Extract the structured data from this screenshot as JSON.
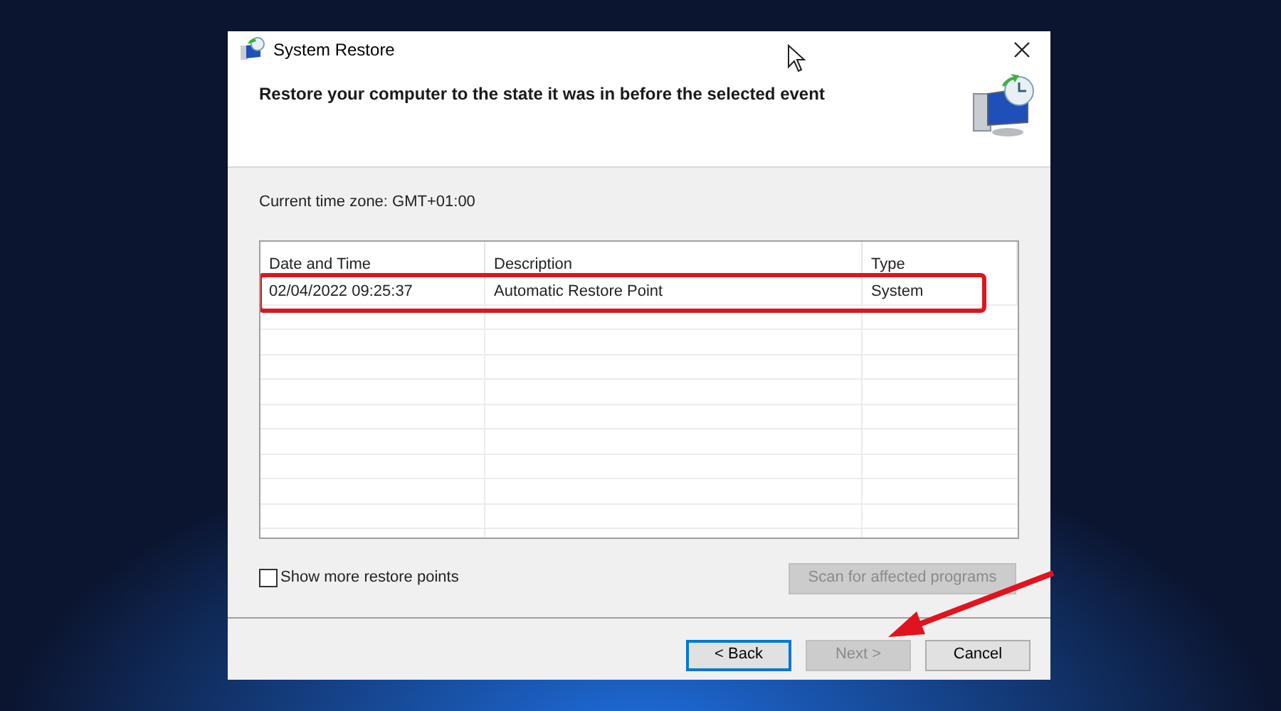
{
  "window": {
    "title": "System Restore"
  },
  "heading": "Restore your computer to the state it was in before the selected event",
  "time_zone": "Current time zone: GMT+01:00",
  "table": {
    "columns": [
      "Date and Time",
      "Description",
      "Type"
    ],
    "rows": [
      {
        "cells": [
          "02/04/2022 09:25:37",
          "Automatic Restore Point",
          "System"
        ],
        "highlighted": true
      }
    ]
  },
  "show_more": {
    "label": "Show more restore points",
    "checked": false
  },
  "scan_button": {
    "label": "Scan for affected programs",
    "disabled": true
  },
  "buttons": [
    {
      "label": "< Back",
      "disabled": false,
      "default": true
    },
    {
      "label": "Next >",
      "disabled": true,
      "default": false
    },
    {
      "label": "Cancel",
      "disabled": false,
      "default": false
    }
  ]
}
